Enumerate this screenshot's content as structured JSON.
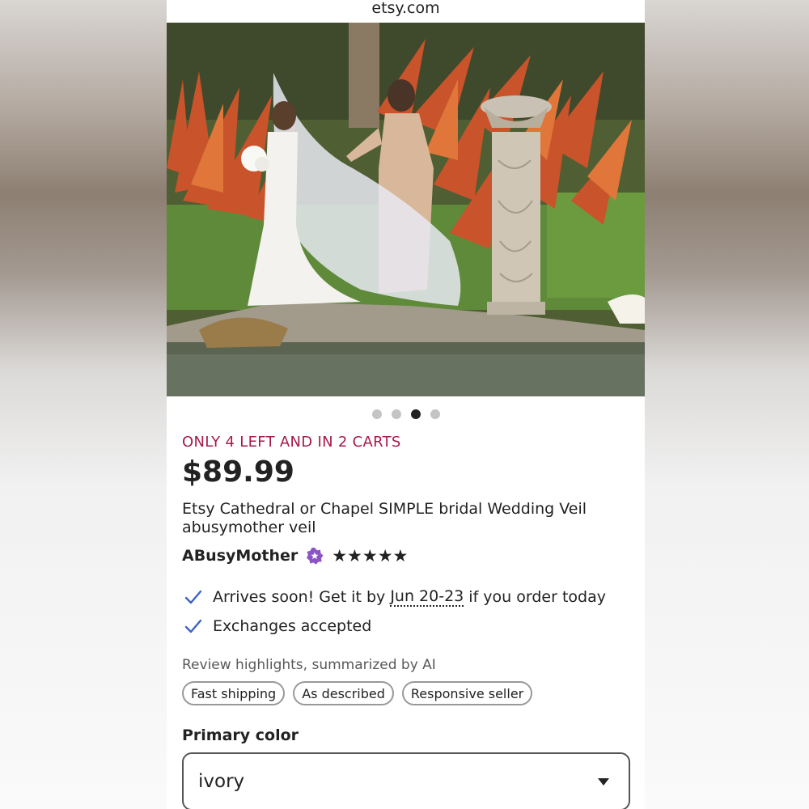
{
  "browser": {
    "url": "etsy.com"
  },
  "gallery": {
    "active_index": 2,
    "dots": [
      {
        "state": "inactive"
      },
      {
        "state": "inactive"
      },
      {
        "state": "active"
      },
      {
        "state": "inactive"
      }
    ]
  },
  "listing": {
    "stock_notice": "ONLY 4 LEFT AND IN 2 CARTS",
    "price": "$89.99",
    "title": "Etsy Cathedral or Chapel SIMPLE bridal Wedding Veil abusymother veil",
    "seller": "ABusyMother",
    "rating_stars": 5,
    "stars_display": "★★★★★",
    "shipping_prefix": "Arrives soon! Get it by ",
    "shipping_date": "Jun 20-23",
    "shipping_suffix": " if you order today",
    "exchanges": "Exchanges accepted"
  },
  "reviews": {
    "label": "Review highlights, summarized by AI",
    "chips": [
      "Fast shipping",
      "As described",
      "Responsive seller"
    ]
  },
  "options": {
    "color_label": "Primary color",
    "color_value": "ivory"
  },
  "colors": {
    "stock_red": "#a61a4a",
    "check_blue": "#3b63c4",
    "star_seller_purple": "#8c55c4"
  }
}
